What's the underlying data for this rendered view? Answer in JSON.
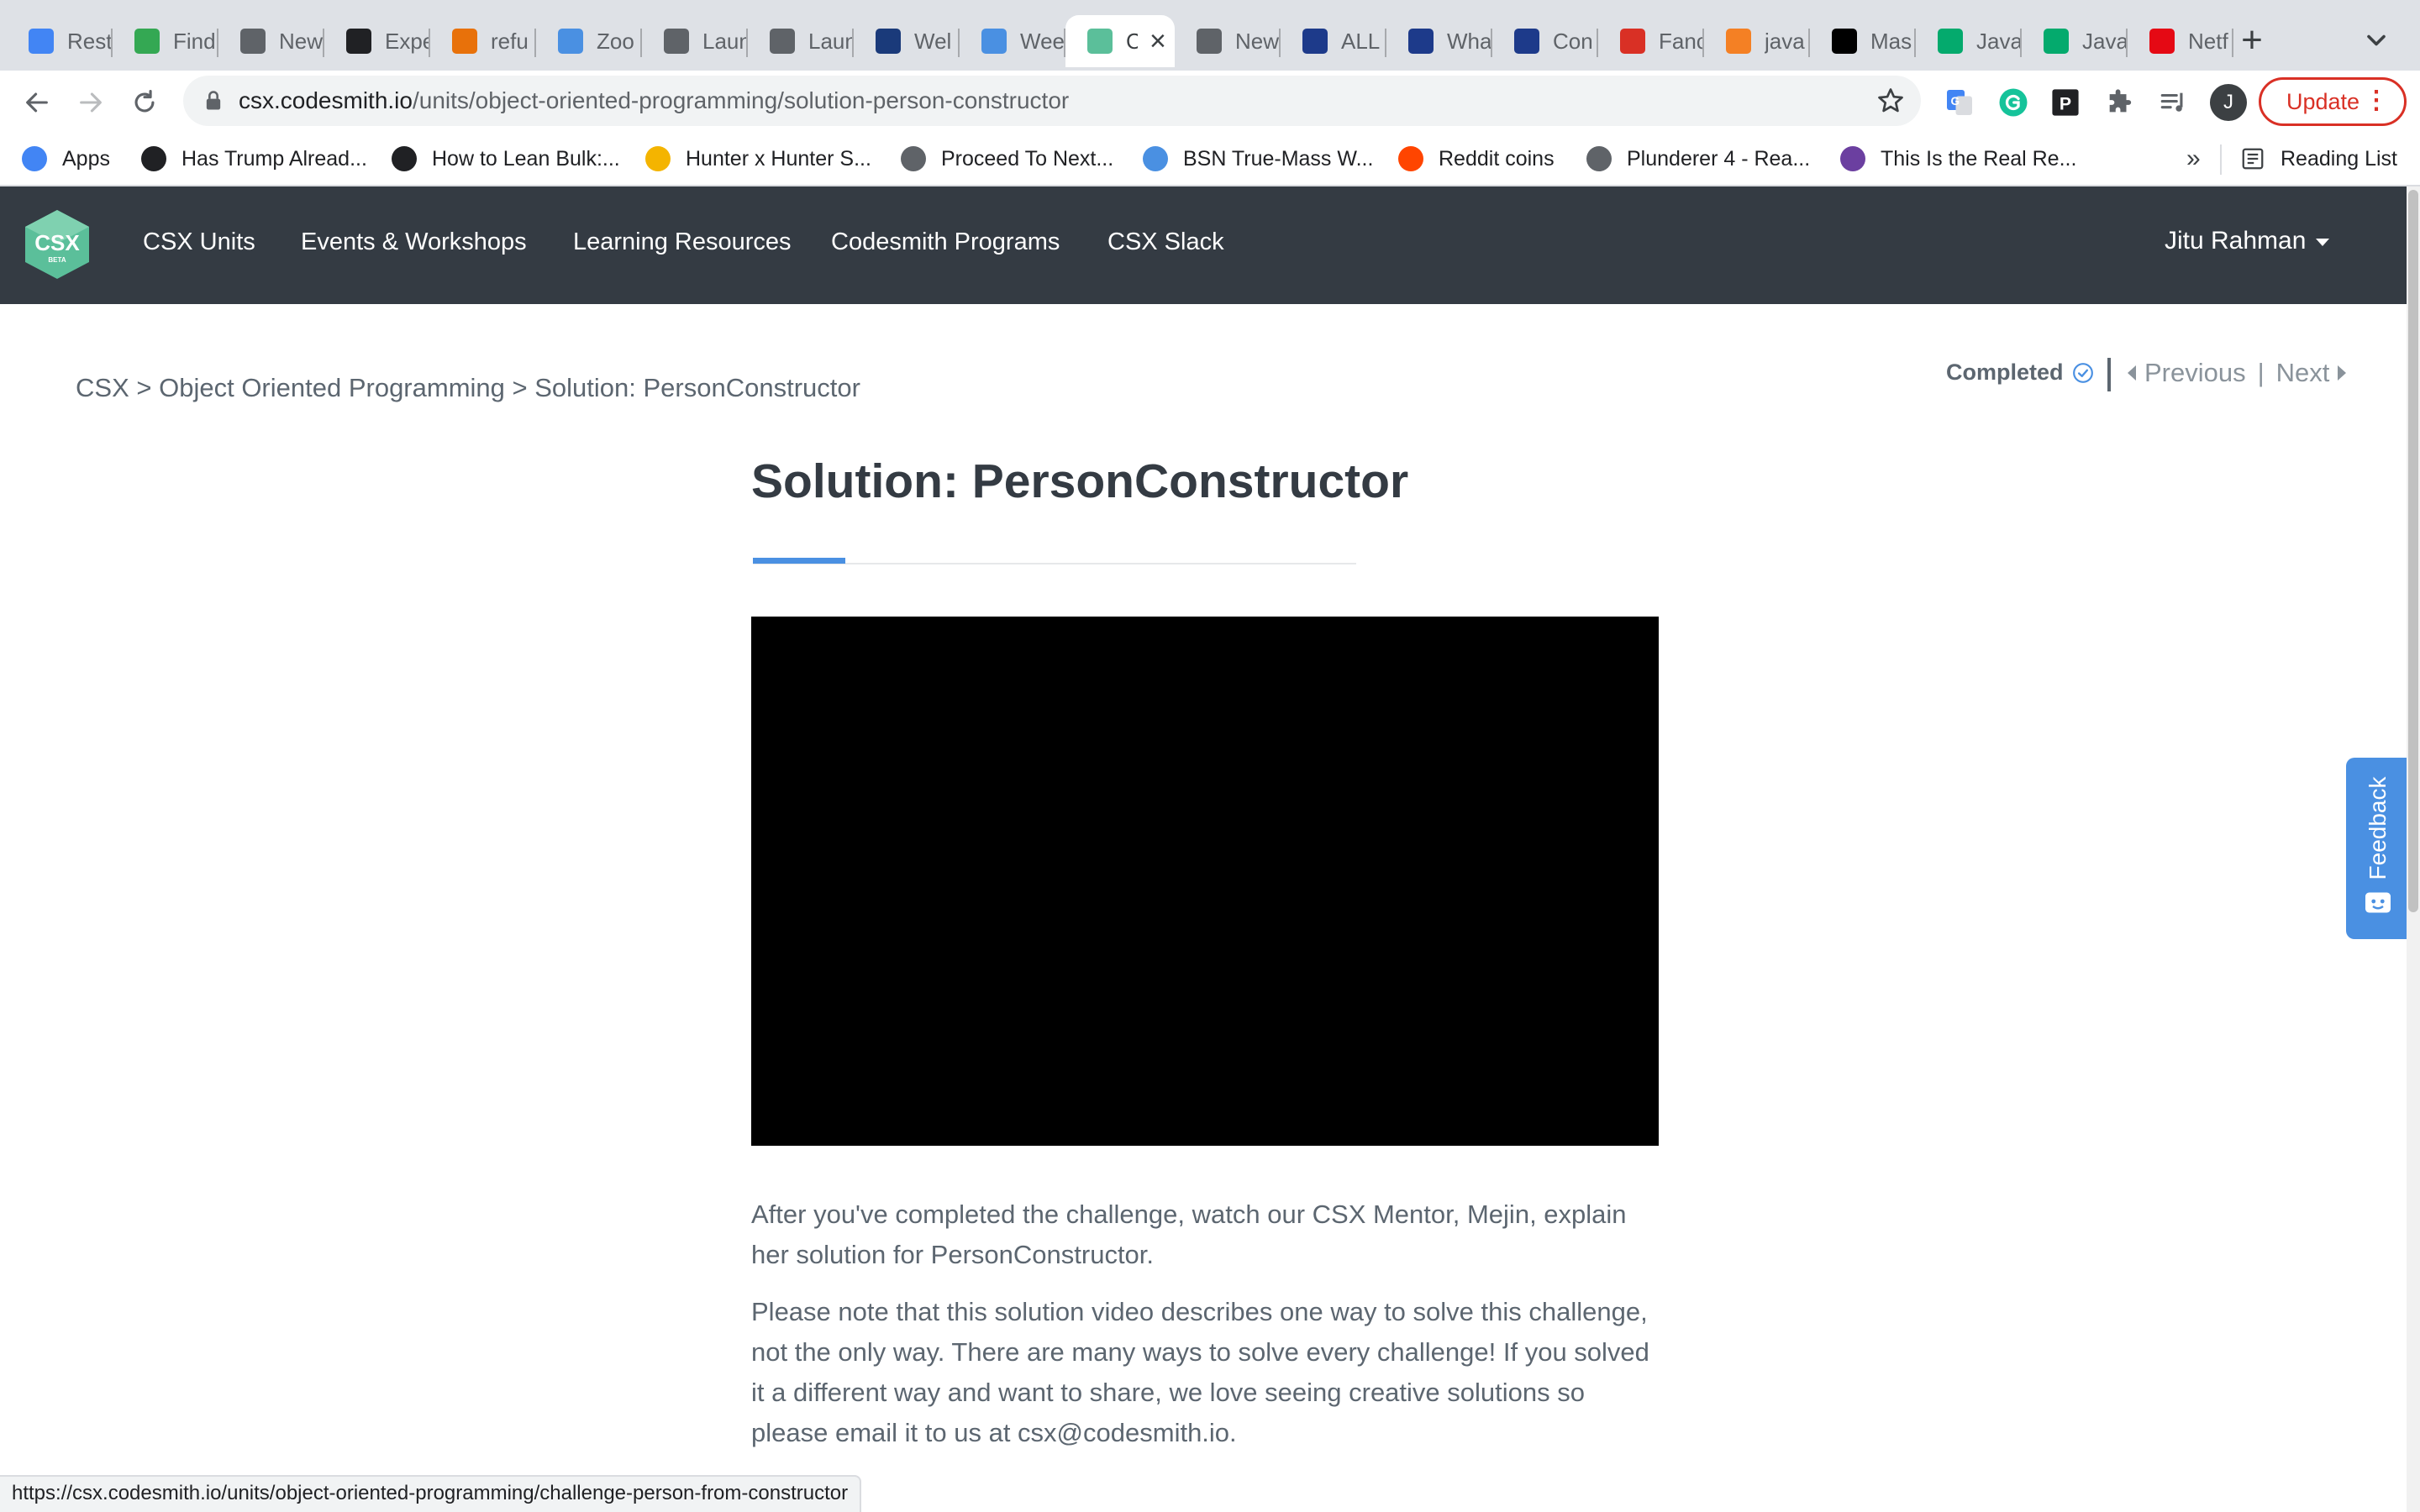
{
  "tabs": [
    {
      "title": "Rest",
      "icon": "google-docs-icon",
      "color": "#4285f4"
    },
    {
      "title": "Find",
      "icon": "glasses-icon",
      "color": "#34a853"
    },
    {
      "title": "New",
      "icon": "chrome-icon",
      "color": "#5f6368"
    },
    {
      "title": "Expe",
      "icon": "compass-icon",
      "color": "#202124"
    },
    {
      "title": "refu",
      "icon": "tp-icon",
      "color": "#e8710a"
    },
    {
      "title": "Zoo",
      "icon": "cap-icon",
      "color": "#4a90e2"
    },
    {
      "title": "Laun",
      "icon": "globe-icon",
      "color": "#5f6368"
    },
    {
      "title": "Laun",
      "icon": "globe-icon",
      "color": "#5f6368"
    },
    {
      "title": "Wel",
      "icon": "bars-icon",
      "color": "#1a3a7a"
    },
    {
      "title": "Wee",
      "icon": "cap-icon",
      "color": "#4a90e2"
    },
    {
      "title": "CSX",
      "icon": "csx-icon",
      "color": "#5bbf9a",
      "active": true
    },
    {
      "title": "New",
      "icon": "chrome-icon",
      "color": "#5f6368"
    },
    {
      "title": "ALL",
      "icon": "seventeen-icon",
      "color": "#1d3a8a"
    },
    {
      "title": "Wha",
      "icon": "seventeen-icon",
      "color": "#1d3a8a"
    },
    {
      "title": "Con",
      "icon": "seventeen-icon",
      "color": "#1d3a8a"
    },
    {
      "title": "Fanc",
      "icon": "checker-icon",
      "color": "#d93025"
    },
    {
      "title": "java",
      "icon": "stack-icon",
      "color": "#f48024"
    },
    {
      "title": "Mas",
      "icon": "dev-icon",
      "color": "#000000"
    },
    {
      "title": "Java",
      "icon": "w3-icon",
      "color": "#04aa6d"
    },
    {
      "title": "Java",
      "icon": "w3-icon",
      "color": "#04aa6d"
    },
    {
      "title": "Netf",
      "icon": "netflix-icon",
      "color": "#e50914"
    }
  ],
  "toolbar": {
    "url_host": "csx.codesmith.io",
    "url_path": "/units/object-oriented-programming/solution-person-constructor",
    "profile_initial": "J",
    "update_label": "Update"
  },
  "bookmarks": [
    {
      "label": "Apps",
      "icon": "apps-grid-icon",
      "color": "#4285f4"
    },
    {
      "label": "Has Trump Alread...",
      "icon": "h-icon",
      "color": "#202124"
    },
    {
      "label": "How to Lean Bulk:...",
      "icon": "g-icon",
      "color": "#202124"
    },
    {
      "label": "Hunter x Hunter S...",
      "icon": "hex-icon",
      "color": "#f4b400"
    },
    {
      "label": "Proceed To Next...",
      "icon": "globe-icon",
      "color": "#5f6368"
    },
    {
      "label": "BSN True-Mass W...",
      "icon": "b-icon",
      "color": "#4a90e2"
    },
    {
      "label": "Reddit coins",
      "icon": "reddit-icon",
      "color": "#ff4500"
    },
    {
      "label": "Plunderer 4 - Rea...",
      "icon": "figure-icon",
      "color": "#5f6368"
    },
    {
      "label": "This Is the Real Re...",
      "icon": "s-icon",
      "color": "#6b3fa0"
    }
  ],
  "reading_list_label": "Reading List",
  "site_nav": {
    "logo_text": "CSX",
    "logo_sub": "BETA",
    "links": [
      "CSX Units",
      "Events & Workshops",
      "Learning Resources",
      "Codesmith Programs",
      "CSX Slack"
    ],
    "user_name": "Jitu Rahman"
  },
  "breadcrumb": {
    "root": "CSX",
    "section": "Object Oriented Programming",
    "current": "Solution: PersonConstructor",
    "separator": ">"
  },
  "lesson_nav": {
    "completed_label": "Completed",
    "previous_label": "Previous",
    "next_label": "Next"
  },
  "page_title": "Solution: PersonConstructor",
  "paragraphs": [
    "After you've completed the challenge, watch our CSX Mentor, Mejin, explain her solution for PersonConstructor.",
    "Please note that this solution video describes one way to solve this challenge, not the only way. There are many ways to solve every challenge! If you solved it a different way and want to share, we love seeing creative solutions so please email it to us at csx@codesmith.io."
  ],
  "feedback_label": "Feedback",
  "status_url": "https://csx.codesmith.io/units/object-oriented-programming/challenge-person-from-constructor",
  "colors": {
    "nav_bg": "#343b43",
    "accent_blue": "#4a90e2",
    "text_gray": "#5c6670",
    "update_red": "#d93025"
  }
}
